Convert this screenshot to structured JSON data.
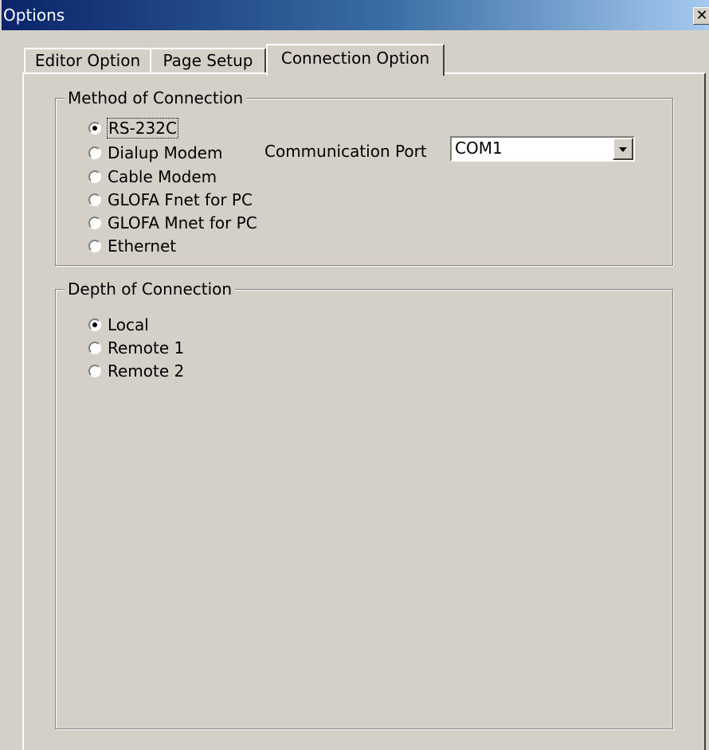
{
  "window": {
    "title": "Options",
    "close_glyph": "✕"
  },
  "tabs": [
    {
      "label": "Editor Option",
      "active": false
    },
    {
      "label": "Page Setup",
      "active": false
    },
    {
      "label": "Connection Option",
      "active": true
    }
  ],
  "method_group": {
    "legend": "Method of Connection",
    "options": [
      {
        "label": "RS-232C",
        "checked": true,
        "focused": true
      },
      {
        "label": "Dialup Modem",
        "checked": false
      },
      {
        "label": "Cable Modem",
        "checked": false
      },
      {
        "label": "GLOFA Fnet for PC",
        "checked": false
      },
      {
        "label": "GLOFA Mnet for PC",
        "checked": false
      },
      {
        "label": "Ethernet",
        "checked": false
      }
    ],
    "port": {
      "label": "Communication Port",
      "value": "COM1",
      "icon": "chevron-down-icon"
    }
  },
  "depth_group": {
    "legend": "Depth of Connection",
    "options": [
      {
        "label": "Local",
        "checked": true
      },
      {
        "label": "Remote 1",
        "checked": false
      },
      {
        "label": "Remote 2",
        "checked": false
      }
    ]
  },
  "colors": {
    "face": "#d4d0c8",
    "title_start": "#0a246a",
    "title_end": "#a6caf0"
  }
}
